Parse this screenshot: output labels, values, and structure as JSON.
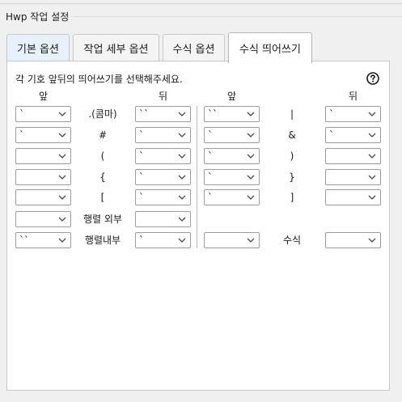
{
  "group": {
    "title": "Hwp 작업 설정"
  },
  "tabs": [
    {
      "label": "기본 옵션"
    },
    {
      "label": "작업 세부 옵션"
    },
    {
      "label": "수식 옵션"
    },
    {
      "label": "수식 띄어쓰기"
    }
  ],
  "active_tab": "수식 띄어쓰기",
  "panel": {
    "instruction": "각 기호 앞뒤의 띄어쓰기를 선택해주세요.",
    "help_icon": "help-circle-icon",
    "left_headers": {
      "before": "앞",
      "after": "뒤"
    },
    "right_headers": {
      "before": "앞",
      "after": "뒤"
    },
    "left_rows": [
      {
        "symbol": ".(콤마)",
        "before": "`",
        "after": "``"
      },
      {
        "symbol": "#",
        "before": "`",
        "after": "`"
      },
      {
        "symbol": "(",
        "before": "",
        "after": "`"
      },
      {
        "symbol": "{",
        "before": "",
        "after": "`"
      },
      {
        "symbol": "[",
        "before": "",
        "after": "`"
      },
      {
        "symbol": "행렬 외부",
        "before": "",
        "after": ""
      },
      {
        "symbol": "행렬내부",
        "before": "``",
        "after": "`"
      }
    ],
    "right_rows": [
      {
        "symbol": "|",
        "before": "``",
        "after": "`"
      },
      {
        "symbol": "&",
        "before": "`",
        "after": "`"
      },
      {
        "symbol": ")",
        "before": "`",
        "after": ""
      },
      {
        "symbol": "}",
        "before": "`",
        "after": ""
      },
      {
        "symbol": "]",
        "before": "`",
        "after": ""
      },
      {
        "symbol": "수식",
        "before": "",
        "after": ""
      }
    ]
  }
}
